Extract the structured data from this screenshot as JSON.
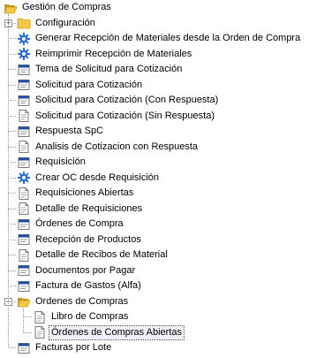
{
  "tree": {
    "root": {
      "label": "Gestión de Compras",
      "expanded": true,
      "icon": "folder-open-icon"
    },
    "children": [
      {
        "label": "Configuración",
        "type": "folder",
        "expanded": false
      },
      {
        "label": "Generar Recepción de Materiales desde la Orden de Compra",
        "type": "process"
      },
      {
        "label": "Reimprimir Recepción de Materiales",
        "type": "process"
      },
      {
        "label": "Tema de Solicitud para Cotización",
        "type": "window"
      },
      {
        "label": "Solicitud para Cotización",
        "type": "window"
      },
      {
        "label": "Solicitud para Cotización (Con Respuesta)",
        "type": "window"
      },
      {
        "label": "Solicitud para Cotización  (Sin Respuesta)",
        "type": "report"
      },
      {
        "label": "Respuesta SpC",
        "type": "window"
      },
      {
        "label": "Analisis de Cotizacion con Respuesta",
        "type": "report"
      },
      {
        "label": "Requisición",
        "type": "window"
      },
      {
        "label": "Crear OC desde Requisición",
        "type": "process"
      },
      {
        "label": "Requisiciones Abiertas",
        "type": "report"
      },
      {
        "label": "Detalle de Requisiciones",
        "type": "report"
      },
      {
        "label": "Órdenes de Compra",
        "type": "window"
      },
      {
        "label": "Recepción de Productos",
        "type": "window"
      },
      {
        "label": "Detalle de Recibos de Material",
        "type": "report"
      },
      {
        "label": "Documentos por Pagar",
        "type": "window"
      },
      {
        "label": "Factura de Gastos (Alfa)",
        "type": "window"
      },
      {
        "label": "Ordenes de Compras",
        "type": "folder",
        "expanded": true,
        "children": [
          {
            "label": "Libro de Compras",
            "type": "report"
          },
          {
            "label": "Órdenes de Compras Abiertas",
            "type": "report",
            "selected": true
          }
        ]
      },
      {
        "label": "Facturas por Lote",
        "type": "window",
        "partial": true
      }
    ]
  },
  "colors": {
    "folder": "#f2c84b",
    "folder_dark": "#c9961e",
    "gear": "#2f6fd0",
    "window_bar": "#1f4f9e",
    "selection": "#eef2f8"
  }
}
